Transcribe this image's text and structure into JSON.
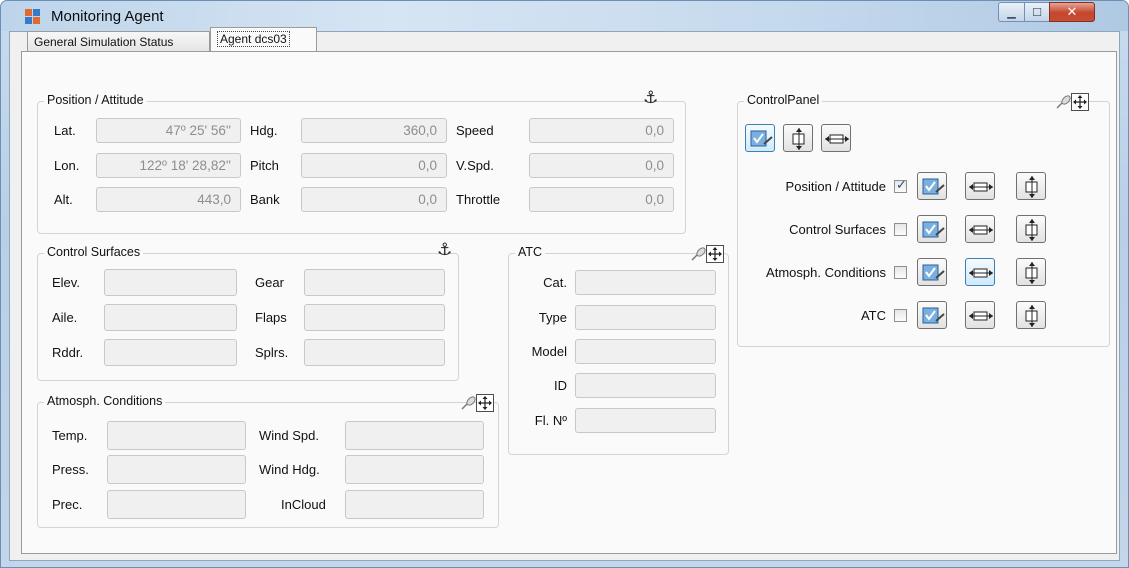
{
  "window": {
    "title": "Monitoring Agent"
  },
  "tabs": [
    {
      "label": "General Simulation Status"
    },
    {
      "label": "Agent dcs03"
    }
  ],
  "position_attitude": {
    "title": "Position / Attitude",
    "lat": {
      "label": "Lat.",
      "value": "47º 25' 56''"
    },
    "lon": {
      "label": "Lon.",
      "value": "122º 18' 28,82''"
    },
    "alt": {
      "label": "Alt.",
      "value": "443,0"
    },
    "hdg": {
      "label": "Hdg.",
      "value": "360,0"
    },
    "pitch": {
      "label": "Pitch",
      "value": "0,0"
    },
    "bank": {
      "label": "Bank",
      "value": "0,0"
    },
    "speed": {
      "label": "Speed",
      "value": "0,0"
    },
    "vspd": {
      "label": "V.Spd.",
      "value": "0,0"
    },
    "throttle": {
      "label": "Throttle",
      "value": "0,0"
    }
  },
  "control_surfaces": {
    "title": "Control Surfaces",
    "elev": {
      "label": "Elev.",
      "value": ""
    },
    "aile": {
      "label": "Aile.",
      "value": ""
    },
    "rddr": {
      "label": "Rddr.",
      "value": ""
    },
    "gear": {
      "label": "Gear",
      "value": ""
    },
    "flaps": {
      "label": "Flaps",
      "value": ""
    },
    "splrs": {
      "label": "Splrs.",
      "value": ""
    }
  },
  "atmosph": {
    "title": "Atmosph. Conditions",
    "temp": {
      "label": "Temp.",
      "value": ""
    },
    "press": {
      "label": "Press.",
      "value": ""
    },
    "prec": {
      "label": "Prec.",
      "value": ""
    },
    "wind_spd": {
      "label": "Wind Spd.",
      "value": ""
    },
    "wind_hdg": {
      "label": "Wind Hdg.",
      "value": ""
    },
    "incloud": {
      "label": "InCloud",
      "value": ""
    }
  },
  "atc": {
    "title": "ATC",
    "cat": {
      "label": "Cat.",
      "value": ""
    },
    "type": {
      "label": "Type",
      "value": ""
    },
    "model": {
      "label": "Model",
      "value": ""
    },
    "id": {
      "label": "ID",
      "value": ""
    },
    "fl_no": {
      "label": "Fl. Nº",
      "value": ""
    }
  },
  "control_panel": {
    "title": "ControlPanel",
    "rows": [
      {
        "label": "Position / Attitude",
        "checked": true
      },
      {
        "label": "Control Surfaces",
        "checked": false
      },
      {
        "label": "Atmosph. Conditions",
        "checked": false
      },
      {
        "label": "ATC",
        "checked": false
      }
    ]
  },
  "icons": {
    "anchor": "anchor-icon",
    "pin": "pin-icon",
    "move": "move-icon",
    "edit": "edit-panel-icon",
    "fit_width": "fit-width-icon",
    "fit_height": "fit-height-icon"
  },
  "colors": {
    "titlebar": "#c5d9ed",
    "close_button": "#c84d33",
    "field_bg": "#f0f0f0",
    "field_text": "#8e8e8e",
    "selected_button_border": "#3c7fb1"
  }
}
